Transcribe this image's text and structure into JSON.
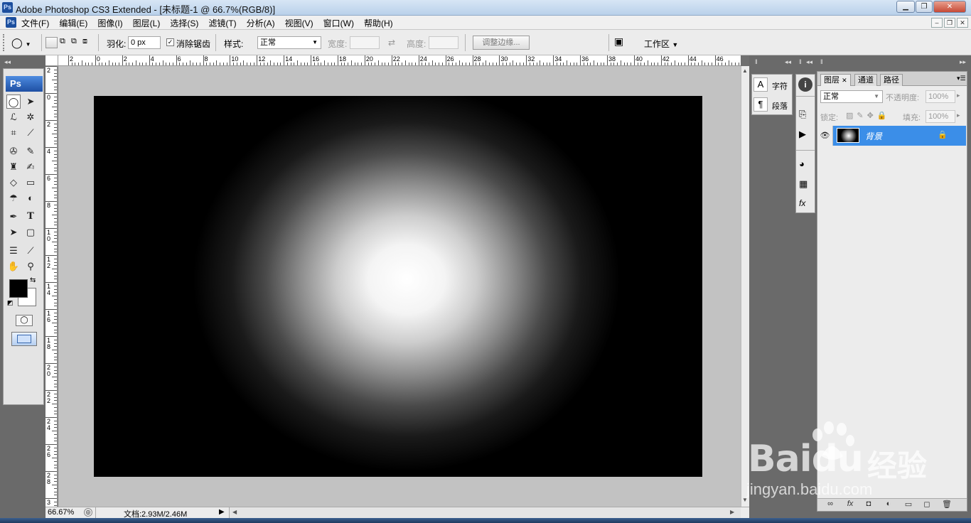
{
  "window": {
    "title": "Adobe Photoshop CS3 Extended - [未标题-1 @ 66.7%(RGB/8)]",
    "app_icon": "Ps"
  },
  "menu": {
    "items": [
      "文件(F)",
      "编辑(E)",
      "图像(I)",
      "图层(L)",
      "选择(S)",
      "滤镜(T)",
      "分析(A)",
      "视图(V)",
      "窗口(W)",
      "帮助(H)"
    ]
  },
  "options": {
    "feather_label": "羽化:",
    "feather_value": "0 px",
    "antialias_label": "消除锯齿",
    "antialias_checked": true,
    "style_label": "样式:",
    "style_value": "正常",
    "width_label": "宽度:",
    "height_label": "高度:",
    "refine_edge_label": "调整边缘...",
    "workspace_label": "工作区"
  },
  "toolbox": {
    "logo": "Ps",
    "foreground_color": "#000000",
    "background_color": "#ffffff"
  },
  "rulers": {
    "h_labels": [
      "2",
      "0",
      "2",
      "4",
      "6",
      "8",
      "10",
      "12",
      "14",
      "16",
      "18",
      "20",
      "22",
      "24",
      "26",
      "28",
      "30",
      "32",
      "34",
      "36",
      "38",
      "40",
      "42",
      "44",
      "46"
    ],
    "v_labels": [
      "2",
      "0",
      "2",
      "4",
      "6",
      "8",
      "1\n0",
      "1\n2",
      "1\n4",
      "1\n6",
      "1\n8",
      "2\n0",
      "2\n2",
      "2\n4",
      "2\n6",
      "2\n8",
      "3"
    ]
  },
  "status": {
    "zoom": "66.67%",
    "doc_info": "文档:2.93M/2.46M"
  },
  "char_panel": {
    "character": "字符",
    "paragraph": "段落"
  },
  "layers_panel": {
    "tabs": [
      "图层",
      "通道",
      "路径"
    ],
    "blend_mode": "正常",
    "opacity_label": "不透明度:",
    "opacity_value": "100%",
    "lock_label": "锁定:",
    "fill_label": "填充:",
    "fill_value": "100%",
    "layer_name": "背景"
  },
  "watermark": {
    "brand": "Bai",
    "brand2": "du",
    "cn": "经验",
    "url": "jingyan.baidu.com"
  }
}
